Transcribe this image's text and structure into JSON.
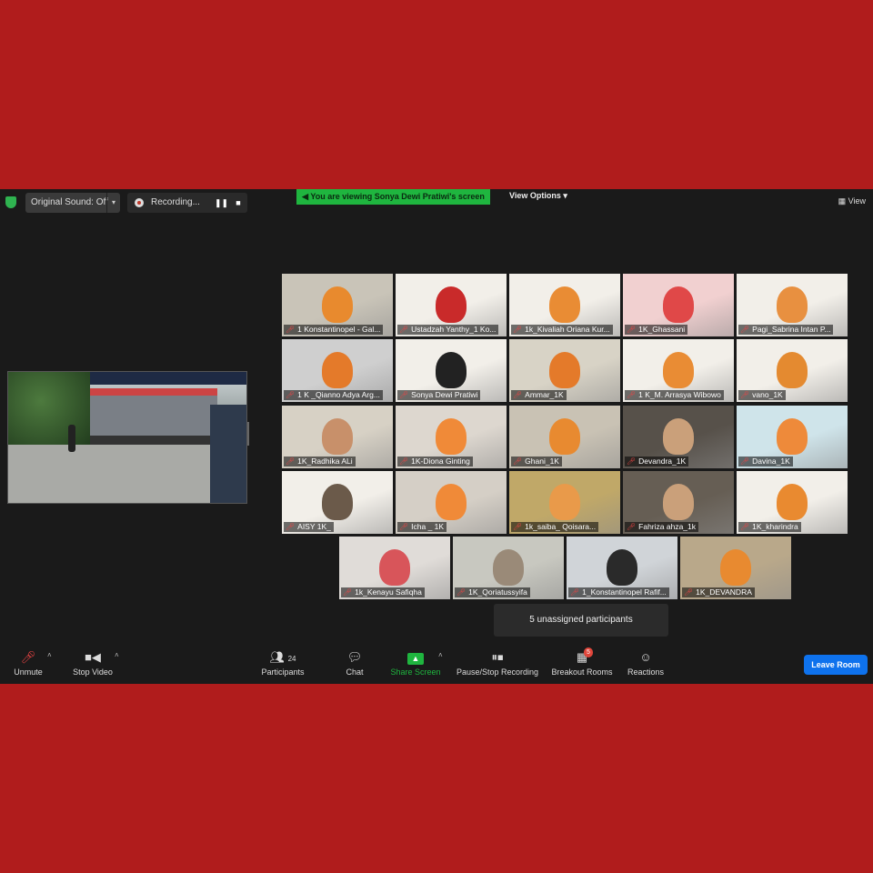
{
  "topbar": {
    "original_sound": "Original Sound: Off",
    "recording": "Recording...",
    "viewing_banner": "You are viewing Sonya Dewi Pratiwi's screen",
    "view_options": "View Options",
    "view": "View"
  },
  "tiles": [
    {
      "name": "1 Konstantinopel - Gal...",
      "bg": "#c9c4b8",
      "face": "#e88a2e"
    },
    {
      "name": "Ustadzah Yanthy_1 Ko...",
      "bg": "#f2efe9",
      "face": "#c92a2a"
    },
    {
      "name": "1k_Kivaliah Oriana Kur...",
      "bg": "#f2efe9",
      "face": "#e98c34"
    },
    {
      "name": "1K_Ghassani",
      "bg": "#f1d0d0",
      "face": "#e04848"
    },
    {
      "name": "Pagi_Sabrina Intan P...",
      "bg": "#f2efe9",
      "face": "#e89040"
    },
    {
      "name": "1 K _Qianno Adya Arg...",
      "bg": "#cfcfcf",
      "face": "#e47a2a"
    },
    {
      "name": "Sonya Dewi Pratiwi",
      "bg": "#f2efe9",
      "face": "#222"
    },
    {
      "name": "Ammar_1K",
      "bg": "#d8d3c6",
      "face": "#e47a2a"
    },
    {
      "name": "1 K_M. Arrasya Wibowo",
      "bg": "#f2efe9",
      "face": "#e98c34"
    },
    {
      "name": "vano_1K",
      "bg": "#f2efe9",
      "face": "#e48a30"
    },
    {
      "name": "1K_Radhika ALi",
      "bg": "#d7d1c5",
      "face": "#c8906a"
    },
    {
      "name": "1K-Diona Ginting",
      "bg": "#ddd7cf",
      "face": "#f08a38"
    },
    {
      "name": "Ghani_1K",
      "bg": "#c9c2b4",
      "face": "#e88a30"
    },
    {
      "name": "Devandra_1K",
      "bg": "#57514a",
      "face": "#caa07a"
    },
    {
      "name": "Davina_1K",
      "bg": "#cfe4ea",
      "face": "#ee8a3a"
    },
    {
      "name": "AISY 1K_",
      "bg": "#f2efe9",
      "face": "#6b5a4a"
    },
    {
      "name": "Icha _ 1K",
      "bg": "#d5cfc6",
      "face": "#f08a38"
    },
    {
      "name": "1k_saiba_ Qoisara...",
      "bg": "#c0a868",
      "face": "#e99a4a"
    },
    {
      "name": "Fahriza ahza_1k",
      "bg": "#665e54",
      "face": "#caa07a"
    },
    {
      "name": "1K_kharindra",
      "bg": "#f2efe9",
      "face": "#e98a30"
    },
    {
      "name": "1k_Kenayu Safiqha",
      "bg": "#e0dcd8",
      "face": "#d8555a"
    },
    {
      "name": "1K_Qoriatussyifa",
      "bg": "#c8c8c0",
      "face": "#9a8a78"
    },
    {
      "name": "1_Konstantinopel Rafif...",
      "bg": "#d0d4d8",
      "face": "#2a2a2a"
    },
    {
      "name": "1K_DEVANDRA",
      "bg": "#b9a88a",
      "face": "#e88a30"
    }
  ],
  "toast": "5 unassigned participants",
  "toolbar": {
    "unmute": "Unmute",
    "stop_video": "Stop Video",
    "participants": "Participants",
    "participants_count": "24",
    "chat": "Chat",
    "share_screen": "Share Screen",
    "pause_stop_recording": "Pause/Stop Recording",
    "breakout_rooms": "Breakout Rooms",
    "breakout_badge": "5",
    "reactions": "Reactions",
    "leave_room": "Leave Room"
  },
  "colors": {
    "frame": "#b01c1c",
    "window": "#1a1a1a",
    "share_green": "#1fb53f",
    "leave_blue": "#0e72ed",
    "active_tile": "#c8e63a"
  }
}
